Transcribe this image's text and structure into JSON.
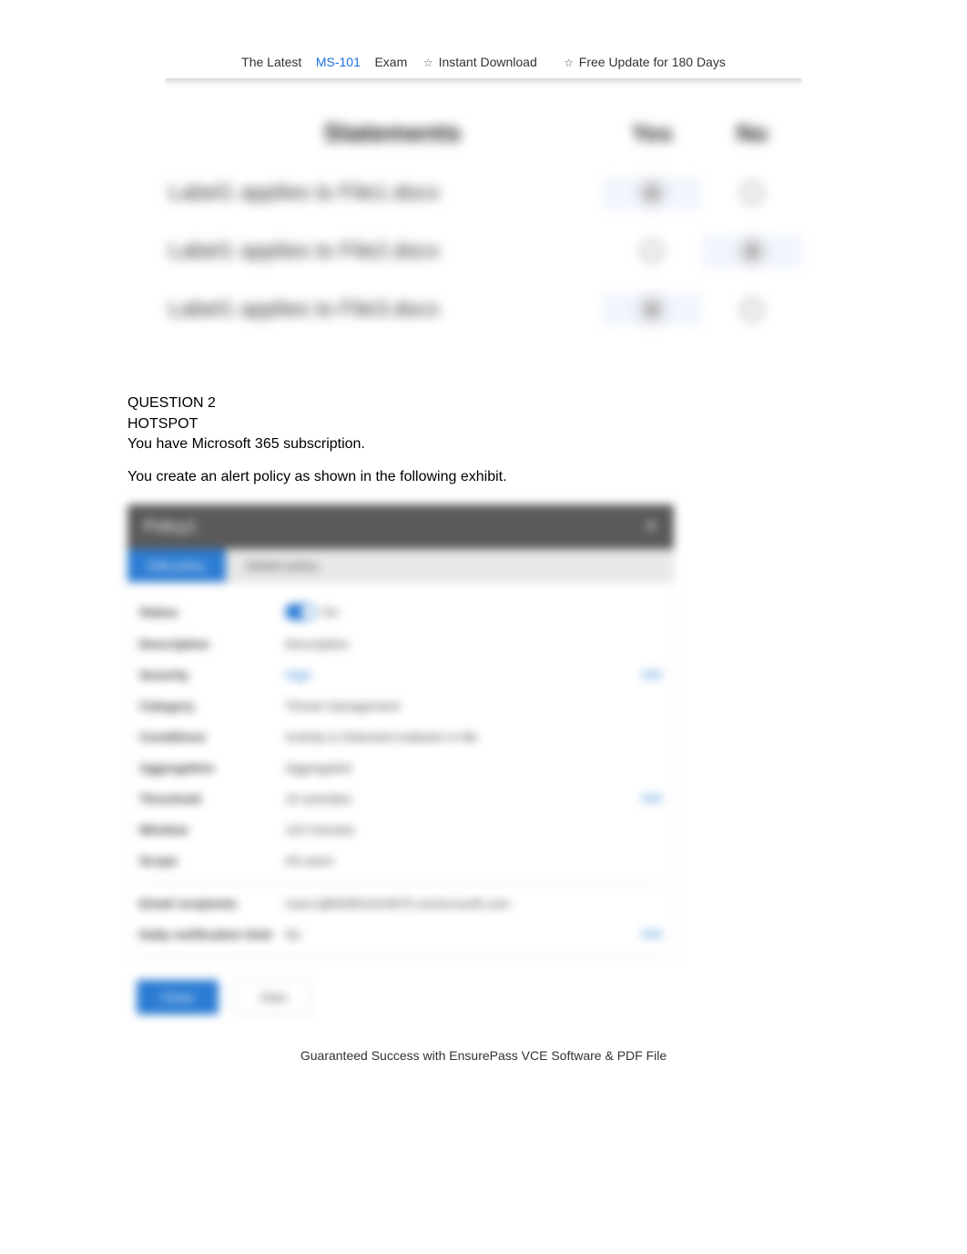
{
  "topbar": {
    "prefix": "The Latest",
    "exam_code": "MS-101",
    "suffix": "Exam",
    "feat1": "Instant Download",
    "feat2": "Free Update for 180 Days",
    "star": "☆"
  },
  "statements": {
    "header_statements": "Statements",
    "header_yes": "Yes",
    "header_no": "No",
    "rows": [
      {
        "text": "Label1 applies to File1.docx",
        "yes_selected": true,
        "no_selected": false
      },
      {
        "text": "Label1 applies to File2.docx",
        "yes_selected": false,
        "no_selected": true
      },
      {
        "text": "Label1 applies to File3.docx",
        "yes_selected": true,
        "no_selected": false
      }
    ]
  },
  "question": {
    "title": "QUESTION 2",
    "type": "HOTSPOT",
    "line1": "You have Microsoft 365 subscription.",
    "line2": "You create an alert policy as shown in the following exhibit."
  },
  "panel": {
    "title": "Policy1",
    "close": "✕",
    "tab_active": "Edit policy",
    "tab_other": "Delete policy",
    "rows": {
      "status_label": "Status",
      "status_value": "On",
      "desc_label": "Description",
      "desc_value": "Description",
      "severity_label": "Severity",
      "severity_value": "High",
      "severity_edit": "Edit",
      "category_label": "Category",
      "category_value": "Threat management",
      "conditions_label": "Conditions",
      "conditions_value": "Activity is Detected malware in file",
      "aggregation_label": "Aggregation",
      "aggregation_value": "Aggregated",
      "threshold_label": "Threshold",
      "threshold_value": "10 activities",
      "threshold_edit": "Edit",
      "window_label": "Window",
      "window_value": "120 minutes",
      "scope_label": "Scope",
      "scope_value": "All users",
      "recipients_label": "Email recipients",
      "recipients_value": "User1@M365x024875.onmicrosoft.com",
      "dailylimit_label": "Daily notification limit",
      "dailylimit_value": "No",
      "dailylimit_edit": "Edit"
    },
    "footer": {
      "close_btn": "Close",
      "other_btn": "View"
    }
  },
  "footer": {
    "note": "Guaranteed Success with EnsurePass VCE Software & PDF File"
  }
}
